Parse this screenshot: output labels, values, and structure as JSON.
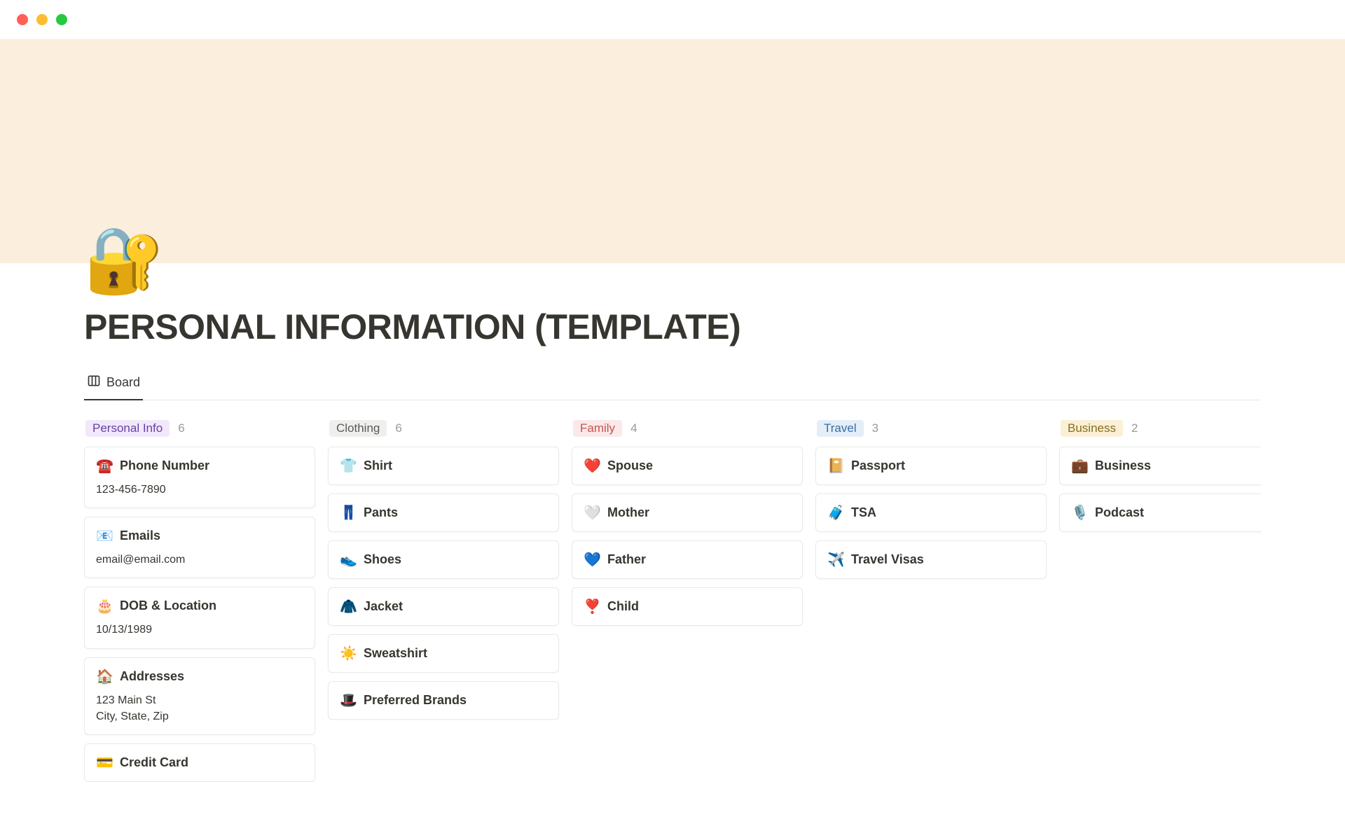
{
  "page": {
    "icon": "🔐",
    "title": "PERSONAL INFORMATION (TEMPLATE)"
  },
  "view": {
    "label": "Board"
  },
  "columns": [
    {
      "label": "Personal Info",
      "count": "6",
      "tagClass": "tag-purple",
      "cards": [
        {
          "icon": "☎️",
          "title": "Phone Number",
          "body": "123-456-7890"
        },
        {
          "icon": "📧",
          "title": "Emails",
          "body": "email@email.com"
        },
        {
          "icon": "🎂",
          "title": "DOB & Location",
          "body": "10/13/1989"
        },
        {
          "icon": "🏠",
          "title": "Addresses",
          "body": "123 Main St\nCity, State, Zip"
        },
        {
          "icon": "💳",
          "title": "Credit Card",
          "body": ""
        }
      ]
    },
    {
      "label": "Clothing",
      "count": "6",
      "tagClass": "tag-gray",
      "cards": [
        {
          "icon": "👕",
          "title": "Shirt",
          "body": ""
        },
        {
          "icon": "👖",
          "title": "Pants",
          "body": ""
        },
        {
          "icon": "👟",
          "title": "Shoes",
          "body": ""
        },
        {
          "icon": "🧥",
          "title": "Jacket",
          "body": ""
        },
        {
          "icon": "☀️",
          "title": "Sweatshirt",
          "body": ""
        },
        {
          "icon": "🎩",
          "title": "Preferred Brands",
          "body": ""
        }
      ]
    },
    {
      "label": "Family",
      "count": "4",
      "tagClass": "tag-red",
      "cards": [
        {
          "icon": "❤️",
          "title": "Spouse",
          "body": ""
        },
        {
          "icon": "🤍",
          "title": "Mother",
          "body": ""
        },
        {
          "icon": "💙",
          "title": "Father",
          "body": ""
        },
        {
          "icon": "❣️",
          "title": "Child",
          "body": ""
        }
      ]
    },
    {
      "label": "Travel",
      "count": "3",
      "tagClass": "tag-blue",
      "cards": [
        {
          "icon": "📔",
          "title": "Passport",
          "body": ""
        },
        {
          "icon": "🧳",
          "title": "TSA",
          "body": ""
        },
        {
          "icon": "✈️",
          "title": "Travel Visas",
          "body": ""
        }
      ]
    },
    {
      "label": "Business",
      "count": "2",
      "tagClass": "tag-yellow",
      "cards": [
        {
          "icon": "💼",
          "title": "Business",
          "body": ""
        },
        {
          "icon": "🎙️",
          "title": "Podcast",
          "body": ""
        }
      ]
    }
  ]
}
